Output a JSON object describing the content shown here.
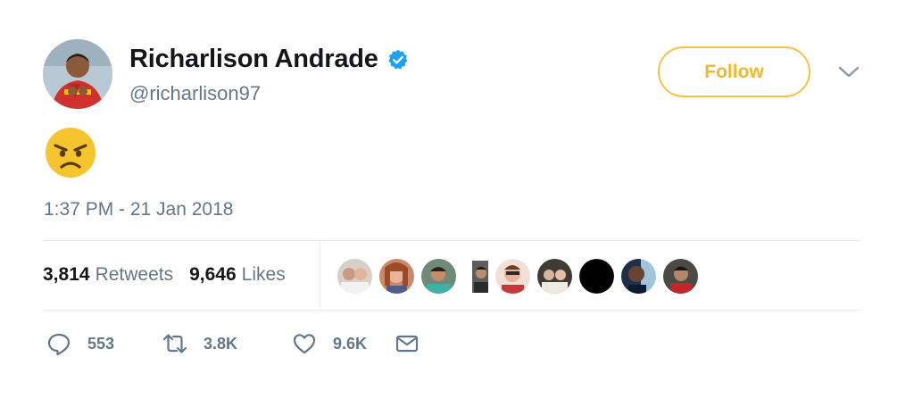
{
  "author": {
    "display_name": "Richarlison Andrade",
    "handle": "@richarlison97",
    "verified": true,
    "avatar_icon": "avatar-photo"
  },
  "follow_button": {
    "label": "Follow"
  },
  "menu_icon": "chevron-down-icon",
  "tweet": {
    "content_emoji": "angry-face-emoji",
    "timestamp": "1:37 PM - 21 Jan 2018"
  },
  "stats": {
    "retweets": {
      "count": "3,814",
      "label": "Retweets"
    },
    "likes": {
      "count": "9,646",
      "label": "Likes"
    }
  },
  "likers_count_shown": 9,
  "actions": {
    "reply": {
      "icon": "reply-icon",
      "count": "553"
    },
    "retweet": {
      "icon": "retweet-icon",
      "count": "3.8K"
    },
    "like": {
      "icon": "heart-icon",
      "count": "9.6K"
    },
    "dm": {
      "icon": "envelope-icon"
    }
  },
  "colors": {
    "follow_border": "#f3c346",
    "follow_text": "#f0b72f",
    "verified": "#1da1f2",
    "secondary_text": "#657786",
    "divider": "#e6ecf0"
  }
}
